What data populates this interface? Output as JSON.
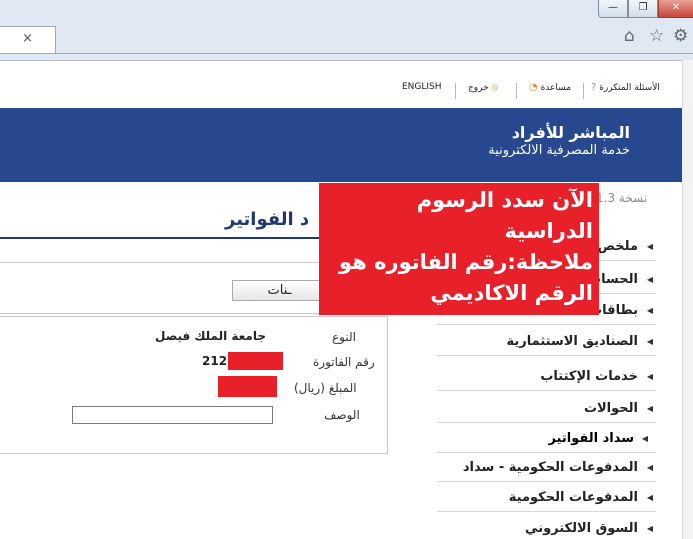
{
  "browser": {
    "tab_close": "×",
    "win_min": "—",
    "win_max": "❐",
    "win_close": "✕",
    "home_icon": "⌂",
    "star_icon": "☆",
    "gear_icon": "⚙"
  },
  "toplinks": {
    "faq": "الأسئلة المتكررة",
    "help": "مساعدة",
    "logout": "خروج",
    "english": "ENGLISH"
  },
  "header": {
    "title": "المباشر للأفراد",
    "subtitle": "خدمة المصرفية الالكترونية"
  },
  "version": "نسخة 1.3",
  "page_title": "د الفواتير",
  "show_button": "ـنات",
  "details": {
    "type_label": "النوع",
    "type_value": "جامعة الملك فيصل",
    "invoice_label": "رقم الفاتورة",
    "invoice_value": "212",
    "amount_label": "المبلغ (ريال)",
    "desc_label": "الوصف"
  },
  "nav": [
    {
      "label": "ملخص",
      "active": false
    },
    {
      "label": "الحساب",
      "active": false
    },
    {
      "label": "بطاقات",
      "active": false
    },
    {
      "label": "الصناديق الاستثمارية",
      "active": false
    },
    {
      "label": "خدمات الإكتتاب",
      "active": false
    },
    {
      "label": "الحوالات",
      "active": false
    },
    {
      "label": "سداد الفواتير",
      "active": true
    },
    {
      "label": "المدفوعات الحكومية - سداد",
      "active": false
    },
    {
      "label": "المدفوعات الحكومية",
      "active": false
    },
    {
      "label": "السوق الالكتروني",
      "active": false
    }
  ],
  "note": {
    "line1": "الآن سدد الرسوم الدراسية",
    "line2": "ملاحظة:رقم الفاتوره هو",
    "line3": "الرقم الاكاديمي"
  },
  "colors": {
    "header_blue": "#27478e",
    "title_navy": "#1f3a6e",
    "note_red": "#e8202a"
  }
}
